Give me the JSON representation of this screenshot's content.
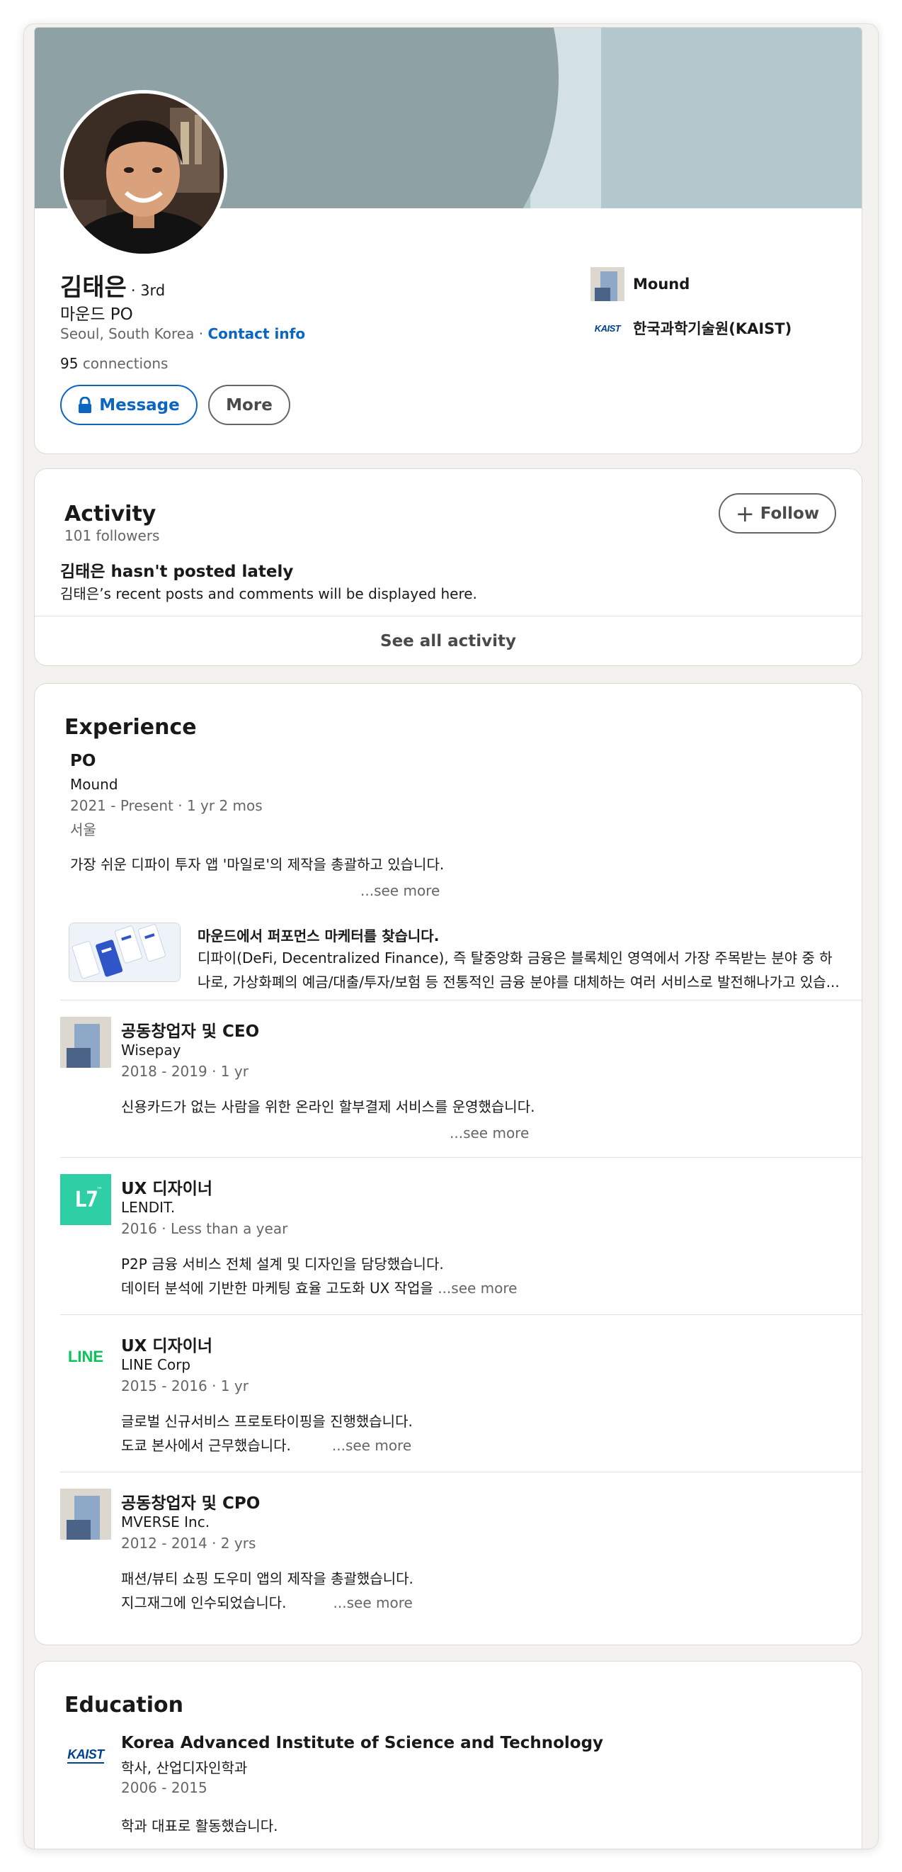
{
  "profile": {
    "name": "김태은",
    "degree": "· 3rd",
    "headline": "마운드 PO",
    "location": "Seoul, South Korea ·",
    "contact_label": "Contact info",
    "connections_count": "95",
    "connections_label": "connections",
    "message_label": "Message",
    "more_label": "More",
    "current_company": "Mound",
    "education_short": "한국과학기술원(KAIST)",
    "kaist_logo_text": "KAIST"
  },
  "activity": {
    "title": "Activity",
    "followers": "101 followers",
    "follow_label": "Follow",
    "empty_title": "김태은 hasn't posted lately",
    "empty_desc": "김태은’s recent posts and comments will be displayed here.",
    "see_all": "See all activity"
  },
  "experience": {
    "title": "Experience",
    "items": [
      {
        "title": "PO",
        "company": "Mound",
        "dates": "2021 - Present · 1 yr 2 mos",
        "location": "서울",
        "desc1": "가장 쉬운 디파이 투자 앱 '마일로'의 제작을 총괄하고 있습니다.",
        "see_more": "...see more",
        "media_title": "마운드에서 퍼포먼스 마케터를 찾습니다.",
        "media_desc1": "디파이(DeFi, Decentralized Finance), 즉 탈중앙화 금융은 블록체인 영역에서 가장 주목받는 분야 중 하",
        "media_desc2": "나로, 가상화폐의 예금/대출/투자/보험 등 전통적인 금융 분야를 대체하는 여러 서비스로 발전해나가고 있습..."
      },
      {
        "title": "공동창업자 및 CEO",
        "company": "Wisepay",
        "dates": "2018 - 2019 · 1 yr",
        "desc1": "신용카드가 없는 사람을 위한 온라인 할부결제 서비스를 운영했습니다.",
        "see_more": "...see more"
      },
      {
        "title": "UX 디자이너",
        "company": "LENDIT.",
        "dates": "2016 · Less than a year",
        "desc1": "P2P 금융 서비스 전체 설계 및 디자인을 담당했습니다.",
        "desc2": "데이터 분석에 기반한 마케팅 효율 고도화 UX 작업을",
        "see_more": "...see more",
        "logo_text": "L7",
        "logo_tm": "™"
      },
      {
        "title": "UX 디자이너",
        "company": "LINE Corp",
        "dates": "2015 - 2016 · 1 yr",
        "desc1": "글로벌 신규서비스 프로토타이핑을 진행했습니다.",
        "desc2": "도쿄 본사에서 근무했습니다.",
        "see_more": "...see more",
        "logo_text": "LINE"
      },
      {
        "title": "공동창업자 및 CPO",
        "company": "MVERSE Inc.",
        "dates": "2012 - 2014 · 2 yrs",
        "desc1": "패션/뷰티 쇼핑 도우미 앱의 제작을 총괄했습니다.",
        "desc2": "지그재그에 인수되었습니다.",
        "see_more": "...see more"
      }
    ]
  },
  "education": {
    "title": "Education",
    "school": "Korea Advanced Institute of Science and Technology",
    "degree": "학사, 산업디자인학과",
    "dates": "2006 - 2015",
    "desc": "학과 대표로 활동했습니다.",
    "logo_text": "KAIST"
  },
  "colors": {
    "link_blue": "#0a66c2",
    "banner_dark": "#8ea2a5",
    "banner_light": "#b3c8cd",
    "lendit_green": "#2fcfa5",
    "line_green": "#06c755",
    "kaist_blue": "#004191"
  }
}
